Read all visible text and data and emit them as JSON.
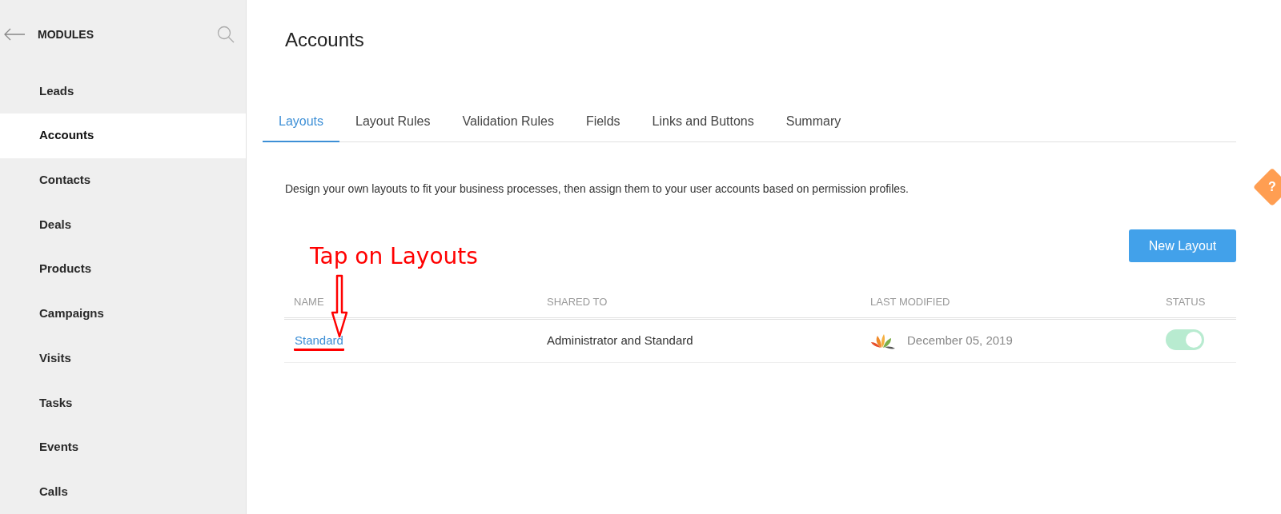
{
  "sidebar": {
    "title": "MODULES",
    "items": [
      {
        "label": "Leads",
        "selected": false
      },
      {
        "label": "Accounts",
        "selected": true
      },
      {
        "label": "Contacts",
        "selected": false
      },
      {
        "label": "Deals",
        "selected": false
      },
      {
        "label": "Products",
        "selected": false
      },
      {
        "label": "Campaigns",
        "selected": false
      },
      {
        "label": "Visits",
        "selected": false
      },
      {
        "label": "Tasks",
        "selected": false
      },
      {
        "label": "Events",
        "selected": false
      },
      {
        "label": "Calls",
        "selected": false
      }
    ]
  },
  "page_title": "Accounts",
  "tabs": [
    {
      "label": "Layouts",
      "selected": true
    },
    {
      "label": "Layout Rules",
      "selected": false
    },
    {
      "label": "Validation Rules",
      "selected": false
    },
    {
      "label": "Fields",
      "selected": false
    },
    {
      "label": "Links and Buttons",
      "selected": false
    },
    {
      "label": "Summary",
      "selected": false
    }
  ],
  "description": "Design your own layouts to fit your business processes, then assign them to your user accounts based on permission profiles.",
  "new_button": "New Layout",
  "table": {
    "columns": [
      "NAME",
      "SHARED TO",
      "LAST MODIFIED",
      "STATUS"
    ],
    "rows": [
      {
        "name": "Standard",
        "shared_to": "Administrator and Standard",
        "last_modified": "December 05, 2019",
        "on": true
      }
    ]
  },
  "help_badge": "?",
  "annotation": {
    "text": "Tap on Layouts"
  }
}
